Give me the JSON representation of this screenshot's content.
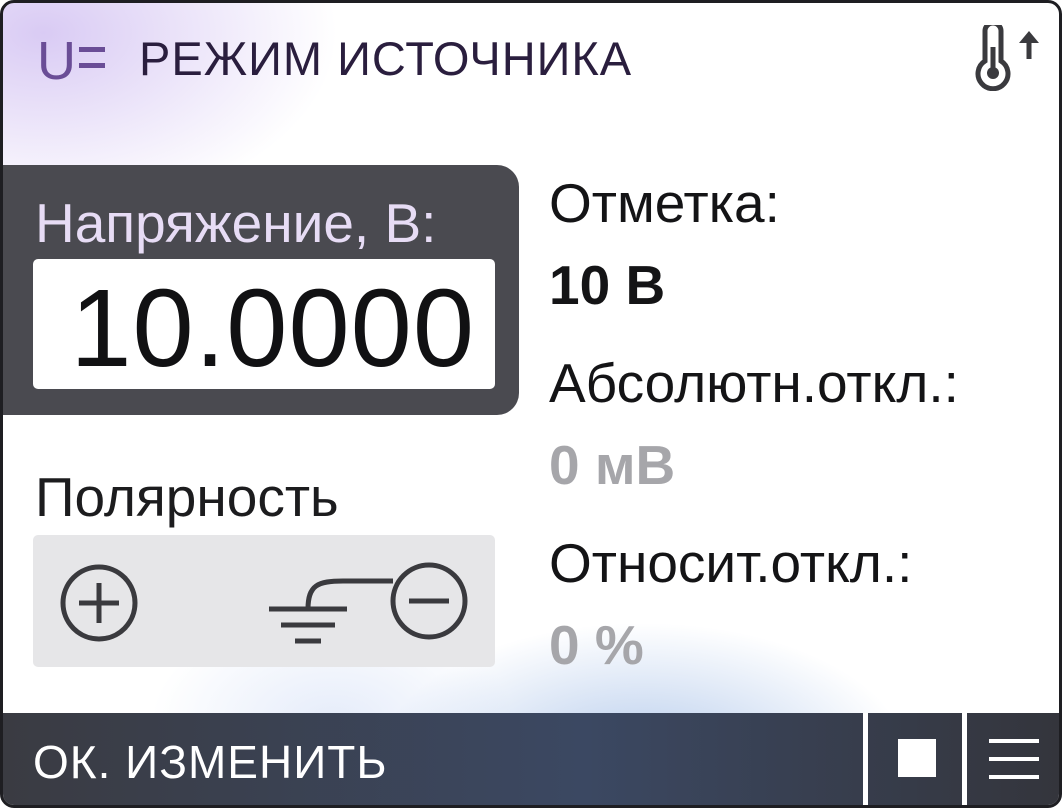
{
  "header": {
    "mode_icon": "dc-voltage-icon",
    "mode_icon_letter": "U",
    "title": "РЕЖИМ ИСТОЧНИКА",
    "temp_icon": "thermometer-up-icon"
  },
  "voltage": {
    "label": "Напряжение, В:",
    "value": "10.0000"
  },
  "polarity": {
    "label": "Полярность",
    "plus_icon": "plus-circle-icon",
    "switch_icon": "ground-minus-switch-icon"
  },
  "info": {
    "mark_label": "Отметка:",
    "mark_value": "10 В",
    "abs_label": "Абсолютн.откл.:",
    "abs_value": "0 мВ",
    "rel_label": "Относит.откл.:",
    "rel_value": "0 %"
  },
  "footer": {
    "action_label": "ОК. ИЗМЕНИТЬ",
    "stop_icon": "stop-icon",
    "menu_icon": "menu-icon"
  }
}
